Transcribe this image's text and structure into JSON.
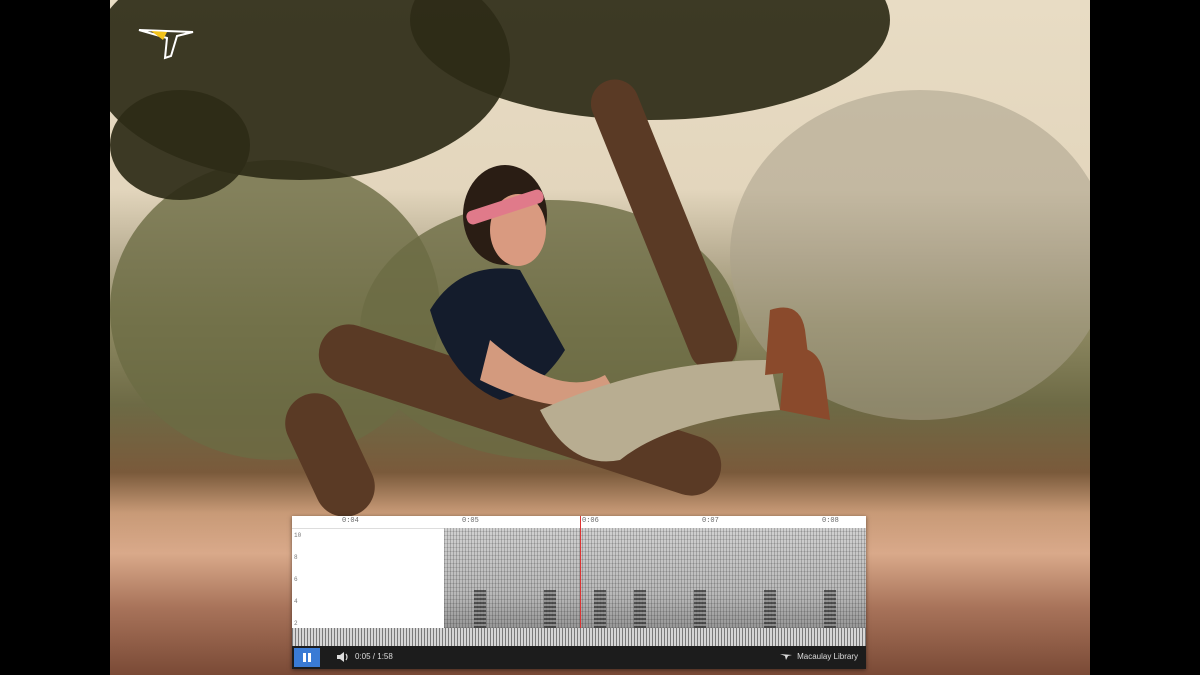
{
  "player": {
    "time_ticks": [
      "0:04",
      "0:05",
      "0:06",
      "0:07",
      "0:08"
    ],
    "freq_ticks": [
      "10",
      "8",
      "6",
      "4",
      "2"
    ],
    "timecode": "0:05 / 1:58",
    "brand": "Macaulay Library",
    "playing": true
  },
  "icons": {
    "header_logo": "bird-logo-icon",
    "pause": "pause-icon",
    "volume": "volume-icon",
    "brand": "bird-logo-icon"
  }
}
